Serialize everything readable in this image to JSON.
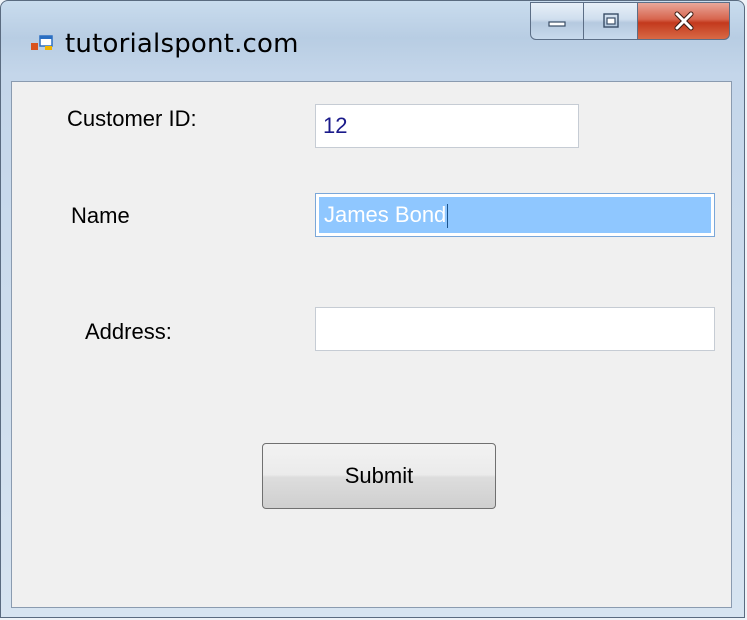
{
  "window": {
    "title": "tutorialspont.com"
  },
  "form": {
    "customer_id_label": "Customer ID:",
    "customer_id_value": "12",
    "name_label": "Name",
    "name_value": "James Bond",
    "address_label": "Address:",
    "address_value": "",
    "submit_label": "Submit"
  },
  "icons": {
    "app": "form-app-icon",
    "minimize": "minimize-icon",
    "maximize": "maximize-icon",
    "close": "close-icon"
  },
  "colors": {
    "selection": "#3399ff",
    "close_button": "#c3391d",
    "input_text": "#1a1a8a"
  }
}
